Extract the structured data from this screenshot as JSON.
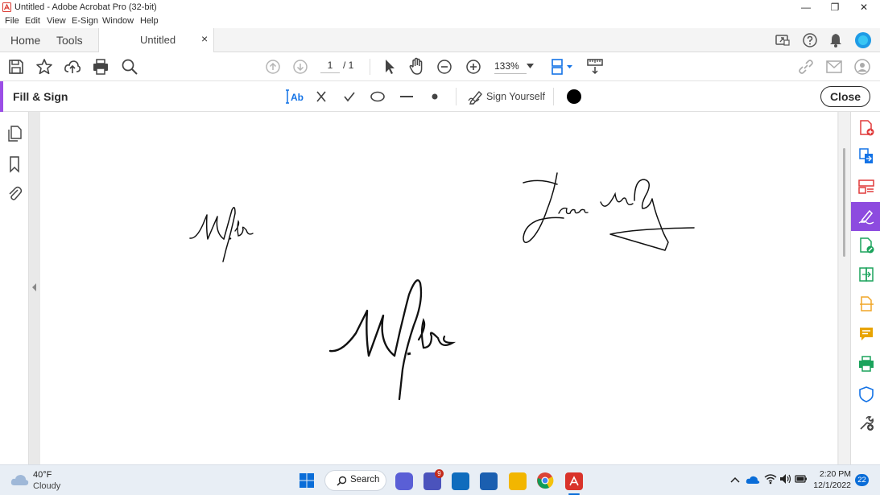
{
  "window": {
    "title": "Untitled - Adobe Acrobat Pro (32-bit)",
    "minimize_label": "—",
    "maximize_label": "❐",
    "close_label": "✕"
  },
  "menu": [
    "File",
    "Edit",
    "View",
    "E-Sign",
    "Window",
    "Help"
  ],
  "tabs": {
    "home": "Home",
    "tools": "Tools",
    "document": "Untitled",
    "close_glyph": "×"
  },
  "toolbar": {
    "page_current": "1",
    "page_total": "/ 1",
    "zoom": "133%"
  },
  "fill_sign": {
    "title": "Fill & Sign",
    "sign_yourself": "Sign Yourself",
    "close_label": "Close",
    "current_color": "#000000"
  },
  "taskbar": {
    "weather_temp": "40°F",
    "weather_desc": "Cloudy",
    "search_label": "Search",
    "teams_badge": "9",
    "time": "2:20 PM",
    "date": "12/1/2022",
    "notification_count": "22"
  },
  "colors": {
    "accent_purple": "#9b4ee6",
    "accent_blue": "#1473e6",
    "acrobat_red": "#d9332b"
  },
  "icons": {
    "right_rail": [
      "create-pdf-icon",
      "export-pdf-icon",
      "organize-pages-icon",
      "fill-sign-icon",
      "edit-pdf-icon",
      "combine-files-icon",
      "scan-icon",
      "comment-icon",
      "print-production-icon",
      "protect-icon",
      "more-tools-icon"
    ]
  }
}
